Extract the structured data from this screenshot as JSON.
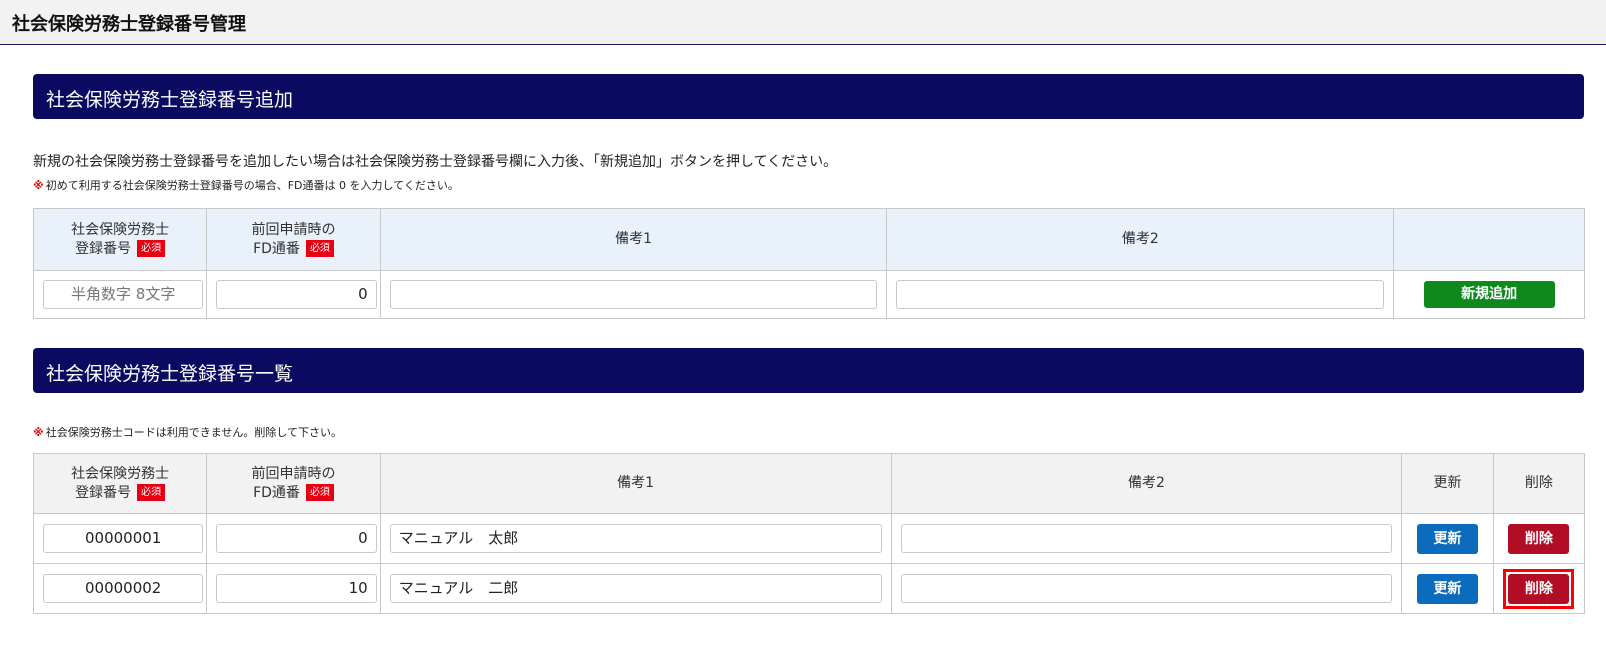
{
  "page": {
    "title": "社会保険労務士登録番号管理"
  },
  "add_section": {
    "title": "社会保険労務士登録番号追加",
    "description": "新規の社会保険労務士登録番号を追加したい場合は社会保険労務士登録番号欄に入力後、「新規追加」ボタンを押してください。",
    "note_mark": "※",
    "note": "初めて利用する社会保険労務士登録番号の場合、FD通番は 0 を入力してください。",
    "headers": {
      "reg_no_line1": "社会保険労務士",
      "reg_no_line2": "登録番号",
      "fd_line1": "前回申請時の",
      "fd_line2": "FD通番",
      "required": "必須",
      "memo1": "備考1",
      "memo2": "備考2"
    },
    "row": {
      "reg_no_placeholder": "半角数字 8文字",
      "fd_value": "0",
      "memo1": "",
      "memo2": ""
    },
    "add_button": "新規追加"
  },
  "list_section": {
    "title": "社会保険労務士登録番号一覧",
    "note_mark": "※",
    "note": "社会保険労務士コードは利用できません。削除して下さい。",
    "headers": {
      "reg_no_line1": "社会保険労務士",
      "reg_no_line2": "登録番号",
      "fd_line1": "前回申請時の",
      "fd_line2": "FD通番",
      "required": "必須",
      "memo1": "備考1",
      "memo2": "備考2",
      "update": "更新",
      "delete": "削除"
    },
    "rows": [
      {
        "reg_no": "00000001",
        "fd": "0",
        "memo1": "マニュアル　太郎",
        "memo2": "",
        "update": "更新",
        "delete": "削除"
      },
      {
        "reg_no": "00000002",
        "fd": "10",
        "memo1": "マニュアル　二郎",
        "memo2": "",
        "update": "更新",
        "delete": "削除"
      }
    ]
  },
  "colors": {
    "section_bar": "#0a0a60",
    "required_badge": "#e60012",
    "add_button": "#0e8a1d",
    "update_button": "#0b6bbd",
    "delete_button": "#b20d24",
    "highlight_frame": "#ff0000"
  }
}
